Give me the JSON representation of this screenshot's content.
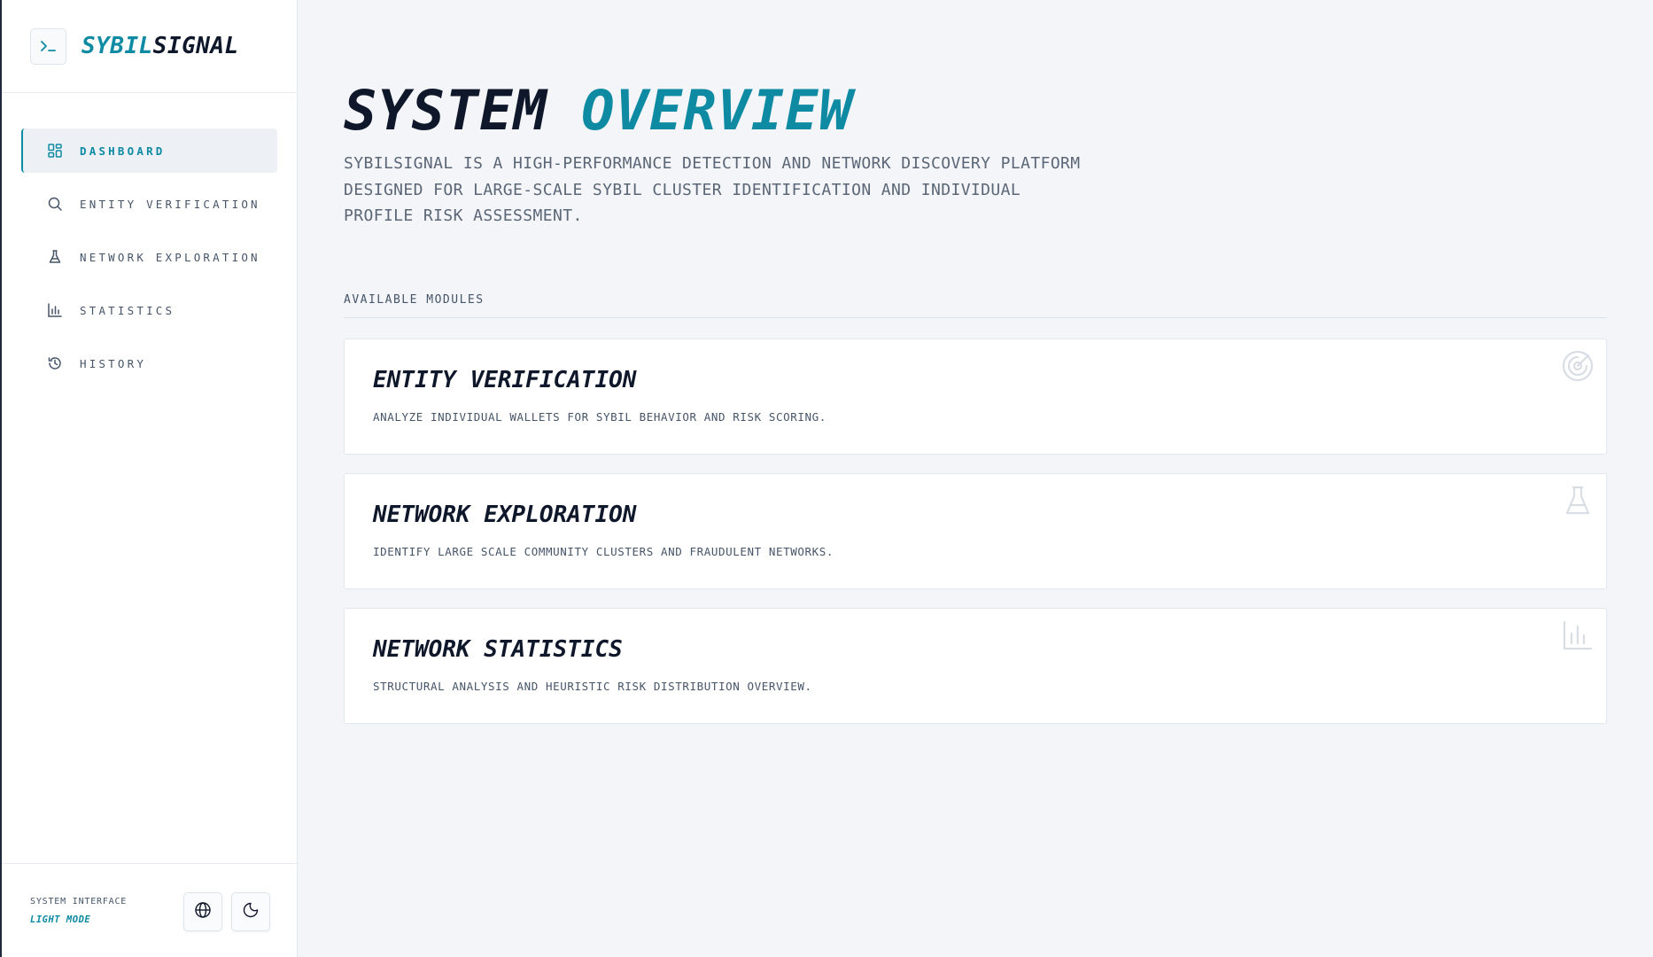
{
  "app": {
    "brand_part1": "SYBIL",
    "brand_part2": "SIGNAL",
    "brand_icon": "terminal-icon"
  },
  "sidebar": {
    "items": [
      {
        "label": "DASHBOARD",
        "icon": "dashboard-icon",
        "active": true
      },
      {
        "label": "ENTITY VERIFICATION",
        "icon": "search-icon",
        "active": false
      },
      {
        "label": "NETWORK EXPLORATION",
        "icon": "flask-icon",
        "active": false
      },
      {
        "label": "STATISTICS",
        "icon": "bar-chart-icon",
        "active": false
      },
      {
        "label": "HISTORY",
        "icon": "history-icon",
        "active": false
      }
    ],
    "footer": {
      "caption": "SYSTEM INTERFACE",
      "mode": "LIGHT MODE",
      "language_icon": "globe-icon",
      "theme_icon": "moon-icon"
    }
  },
  "main": {
    "title_part1": "SYSTEM",
    "title_part2": "OVERVIEW",
    "description": "SYBILSIGNAL IS A HIGH-PERFORMANCE DETECTION AND NETWORK DISCOVERY PLATFORM DESIGNED FOR LARGE-SCALE SYBIL CLUSTER IDENTIFICATION AND INDIVIDUAL PROFILE RISK ASSESSMENT.",
    "section_label": "AVAILABLE MODULES",
    "modules": [
      {
        "title": "ENTITY VERIFICATION",
        "description": "ANALYZE INDIVIDUAL WALLETS FOR SYBIL BEHAVIOR AND RISK SCORING.",
        "icon": "radar-icon"
      },
      {
        "title": "NETWORK EXPLORATION",
        "description": "IDENTIFY LARGE SCALE COMMUNITY CLUSTERS AND FRAUDULENT NETWORKS.",
        "icon": "flask-icon"
      },
      {
        "title": "NETWORK STATISTICS",
        "description": "STRUCTURAL ANALYSIS AND HEURISTIC RISK DISTRIBUTION OVERVIEW.",
        "icon": "bar-chart-icon"
      }
    ]
  },
  "colors": {
    "accent": "#0e8aa3",
    "text": "#0f172a",
    "muted": "#475569",
    "background": "#f3f5f8"
  }
}
